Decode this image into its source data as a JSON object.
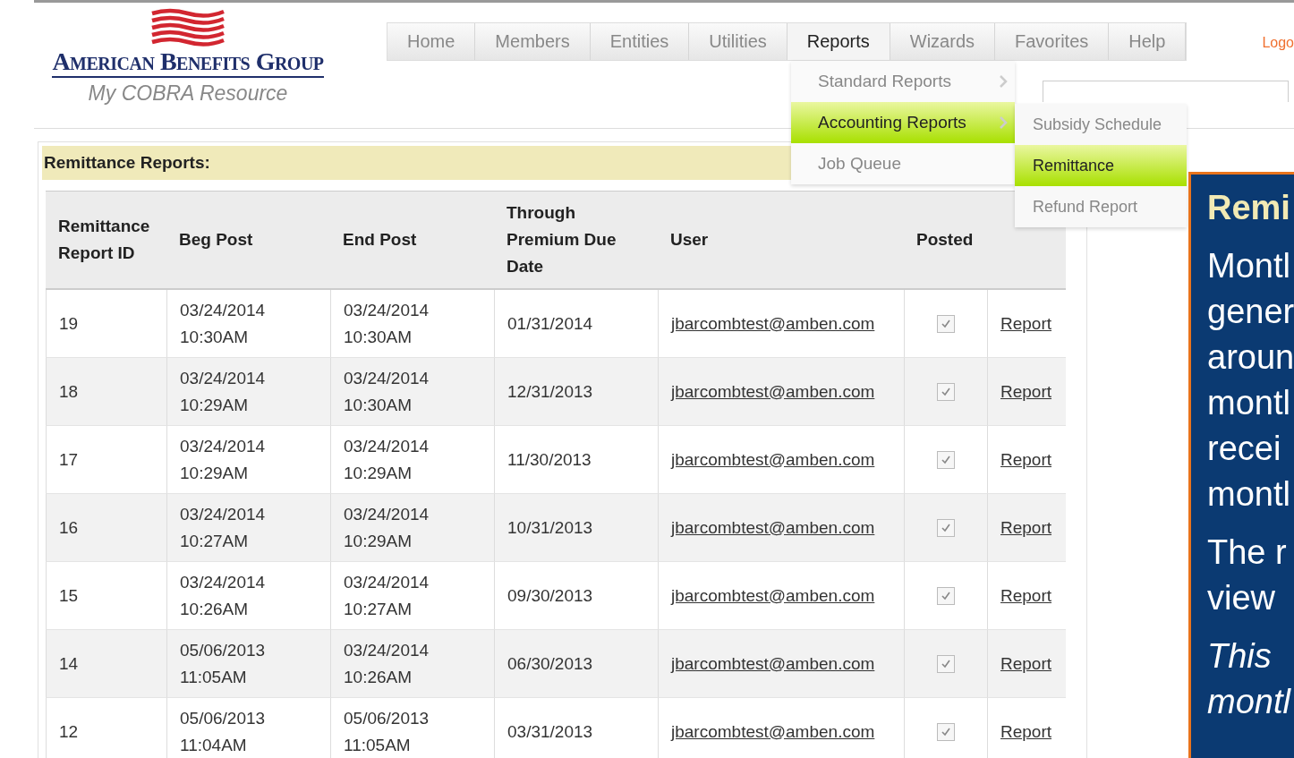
{
  "logo": {
    "name": "American Benefits Group",
    "tagline": "My COBRA Resource"
  },
  "nav": [
    {
      "label": "Home",
      "selected": false
    },
    {
      "label": "Members",
      "selected": false
    },
    {
      "label": "Entities",
      "selected": false
    },
    {
      "label": "Utilities",
      "selected": false
    },
    {
      "label": "Reports",
      "selected": true
    },
    {
      "label": "Wizards",
      "selected": false
    },
    {
      "label": "Favorites",
      "selected": false
    },
    {
      "label": "Help",
      "selected": false
    }
  ],
  "logoff": "Logo",
  "menu": [
    {
      "label": "Standard Reports",
      "selected": false,
      "submenu": true
    },
    {
      "label": "Accounting Reports",
      "selected": true,
      "submenu": true
    },
    {
      "label": "Job Queue",
      "selected": false,
      "submenu": false
    }
  ],
  "submenu": [
    {
      "label": "Subsidy Schedule",
      "selected": false
    },
    {
      "label": "Remittance",
      "selected": true
    },
    {
      "label": "Refund Report",
      "selected": false
    }
  ],
  "panel_title": "Remittance Reports:",
  "table": {
    "columns": [
      "Remittance Report ID",
      "Beg Post",
      "End Post",
      "Through Premium Due Date",
      "User",
      "Posted"
    ],
    "rows": [
      {
        "id": "19",
        "beg": [
          "03/24/2014",
          "10:30AM"
        ],
        "end": [
          "03/24/2014",
          "10:30AM"
        ],
        "due": "01/31/2014",
        "user": "jbarcombtest@amben.com",
        "posted": true,
        "link": "Report"
      },
      {
        "id": "18",
        "beg": [
          "03/24/2014",
          "10:29AM"
        ],
        "end": [
          "03/24/2014",
          "10:30AM"
        ],
        "due": "12/31/2013",
        "user": "jbarcombtest@amben.com",
        "posted": true,
        "link": "Report"
      },
      {
        "id": "17",
        "beg": [
          "03/24/2014",
          "10:29AM"
        ],
        "end": [
          "03/24/2014",
          "10:29AM"
        ],
        "due": "11/30/2013",
        "user": "jbarcombtest@amben.com",
        "posted": true,
        "link": "Report"
      },
      {
        "id": "16",
        "beg": [
          "03/24/2014",
          "10:27AM"
        ],
        "end": [
          "03/24/2014",
          "10:29AM"
        ],
        "due": "10/31/2013",
        "user": "jbarcombtest@amben.com",
        "posted": true,
        "link": "Report"
      },
      {
        "id": "15",
        "beg": [
          "03/24/2014",
          "10:26AM"
        ],
        "end": [
          "03/24/2014",
          "10:27AM"
        ],
        "due": "09/30/2013",
        "user": "jbarcombtest@amben.com",
        "posted": true,
        "link": "Report"
      },
      {
        "id": "14",
        "beg": [
          "05/06/2013",
          "11:05AM"
        ],
        "end": [
          "03/24/2014",
          "10:26AM"
        ],
        "due": "06/30/2013",
        "user": "jbarcombtest@amben.com",
        "posted": true,
        "link": "Report"
      },
      {
        "id": "12",
        "beg": [
          "05/06/2013",
          "11:04AM"
        ],
        "end": [
          "05/06/2013",
          "11:05AM"
        ],
        "due": "03/31/2013",
        "user": "jbarcombtest@amben.com",
        "posted": true,
        "link": "Report"
      }
    ]
  },
  "callout": {
    "title": "Remi",
    "lines": [
      [
        "Montl",
        "gener",
        "aroun",
        "montl",
        "recei",
        "montl"
      ],
      [
        "The r",
        "view"
      ],
      [
        "This",
        "montl"
      ]
    ]
  }
}
